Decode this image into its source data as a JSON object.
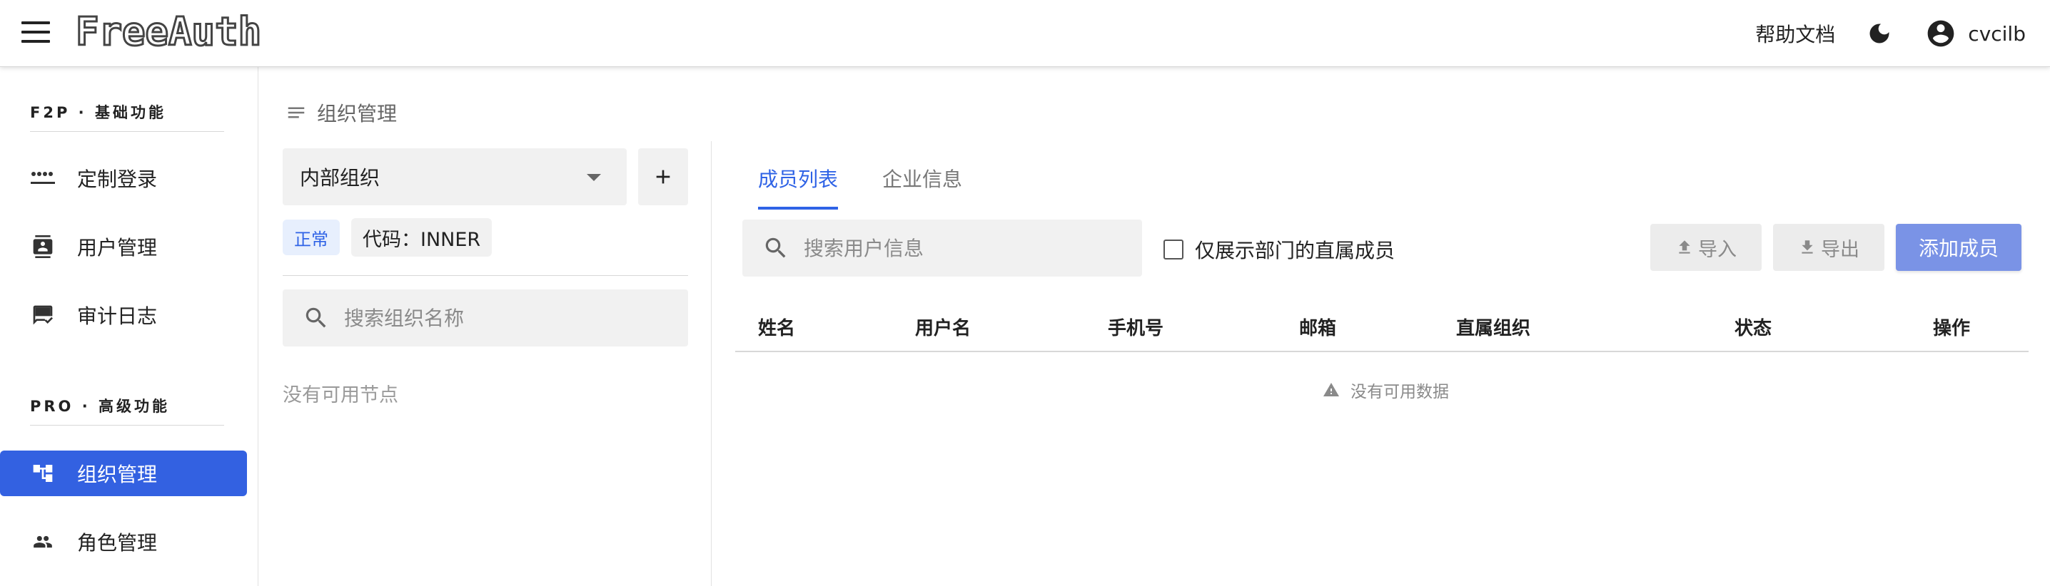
{
  "header": {
    "logo_text": "FreeAuth",
    "help_label": "帮助文档",
    "username": "cvcilb"
  },
  "sidebar": {
    "sections": [
      {
        "title": "F2P · 基础功能"
      },
      {
        "title": "PRO · 高级功能"
      }
    ],
    "items": [
      {
        "label": "定制登录",
        "icon": "password-dots-icon"
      },
      {
        "label": "用户管理",
        "icon": "contact-card-icon"
      },
      {
        "label": "审计日志",
        "icon": "review-chat-icon"
      },
      {
        "label": "组织管理",
        "icon": "org-tree-icon",
        "active": true
      },
      {
        "label": "角色管理",
        "icon": "people-icon"
      }
    ]
  },
  "breadcrumb": {
    "label": "组织管理"
  },
  "org_panel": {
    "selected_org": "内部组织",
    "status_tag": "正常",
    "code_tag": "代码：INNER",
    "search_placeholder": "搜索组织名称",
    "empty_text": "没有可用节点"
  },
  "tabs": [
    {
      "label": "成员列表",
      "active": true
    },
    {
      "label": "企业信息",
      "active": false
    }
  ],
  "members": {
    "search_placeholder": "搜索用户信息",
    "direct_only_label": "仅展示部门的直属成员",
    "direct_only_checked": false,
    "import_label": "导入",
    "export_label": "导出",
    "add_label": "添加成员",
    "columns": [
      "姓名",
      "用户名",
      "手机号",
      "邮箱",
      "直属组织",
      "状态",
      "操作"
    ],
    "rows": [],
    "empty_text": "没有可用数据"
  },
  "colors": {
    "accent": "#3361e1",
    "tab_active": "#2f63e6",
    "add_button": "#7a93e6",
    "status_tag_bg": "#e7effd"
  }
}
